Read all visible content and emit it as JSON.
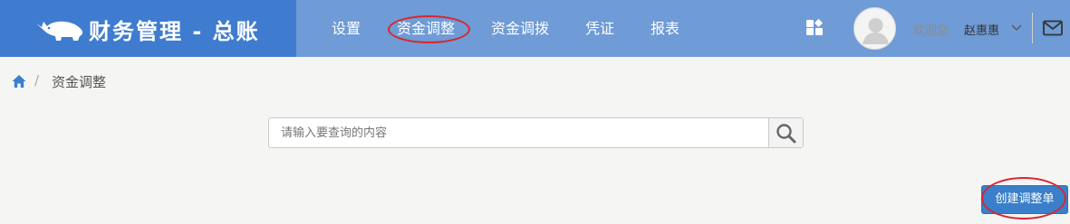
{
  "header": {
    "brand_title": "财务管理 - 总账",
    "nav": [
      "设置",
      "资金调整",
      "资金调拨",
      "凭证",
      "报表"
    ],
    "welcome": "欢迎您",
    "username": "赵惠惠"
  },
  "breadcrumb": {
    "current": "资金调整"
  },
  "search": {
    "placeholder": "请输入要查询的内容",
    "value": ""
  },
  "actions": {
    "create_label": "创建调整单"
  },
  "annotations": {
    "highlight_color": "#d9262c"
  },
  "colors": {
    "brand_bg": "#3f7cd0",
    "nav_bg": "#6f9bd6",
    "primary_button": "#3a7fc9"
  },
  "icons": [
    "rhino-logo-icon",
    "apps-grid-icon",
    "user-avatar-icon",
    "chevron-down-icon",
    "mail-icon",
    "home-icon",
    "search-icon"
  ]
}
